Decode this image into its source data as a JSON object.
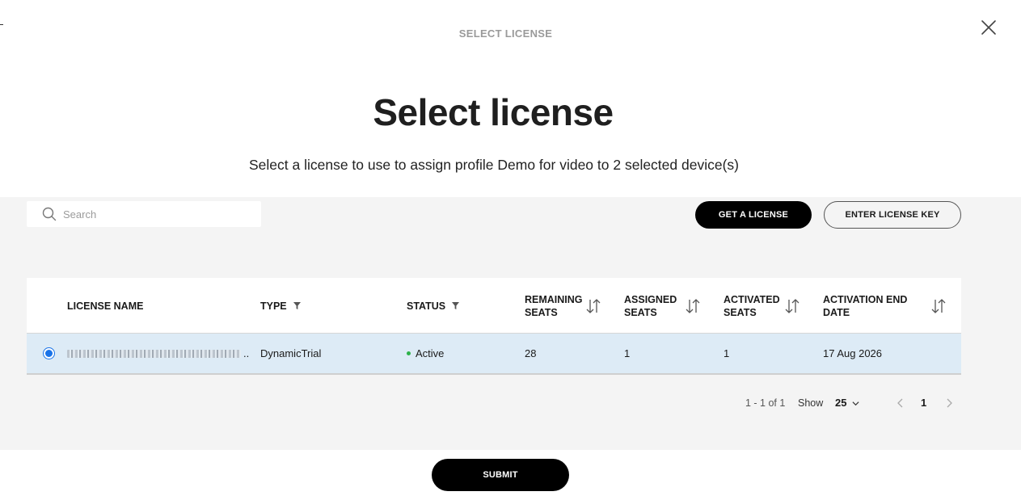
{
  "header": {
    "top_label": "SELECT LICENSE",
    "title": "Select license",
    "subtitle": "Select a license to use to assign profile Demo for video to 2 selected device(s)"
  },
  "toolbar": {
    "search_placeholder": "Search",
    "get_license_label": "GET A LICENSE",
    "enter_key_label": "ENTER LICENSE KEY"
  },
  "table": {
    "columns": {
      "name": "LICENSE NAME",
      "type": "TYPE",
      "status": "STATUS",
      "remaining_l1": "REMAINING",
      "remaining_l2": "SEATS",
      "assigned_l1": "ASSIGNED",
      "assigned_l2": "SEATS",
      "activated_l1": "ACTIVATED",
      "activated_l2": "SEATS",
      "end_l1": "ACTIVATION END",
      "end_l2": "DATE"
    },
    "rows": [
      {
        "selected": true,
        "name_suffix": "..",
        "type": "DynamicTrial",
        "status": "Active",
        "remaining": "28",
        "assigned": "1",
        "activated": "1",
        "end_date": "17 Aug 2026"
      }
    ]
  },
  "pagination": {
    "range": "1 - 1 of 1",
    "show_label": "Show",
    "page_size": "25",
    "current_page": "1"
  },
  "footer": {
    "submit_label": "SUBMIT"
  },
  "colors": {
    "accent": "#1a73e8",
    "status_active": "#2eb24a",
    "selected_row": "#ddebf6",
    "panel_bg": "#f4f4f4"
  }
}
